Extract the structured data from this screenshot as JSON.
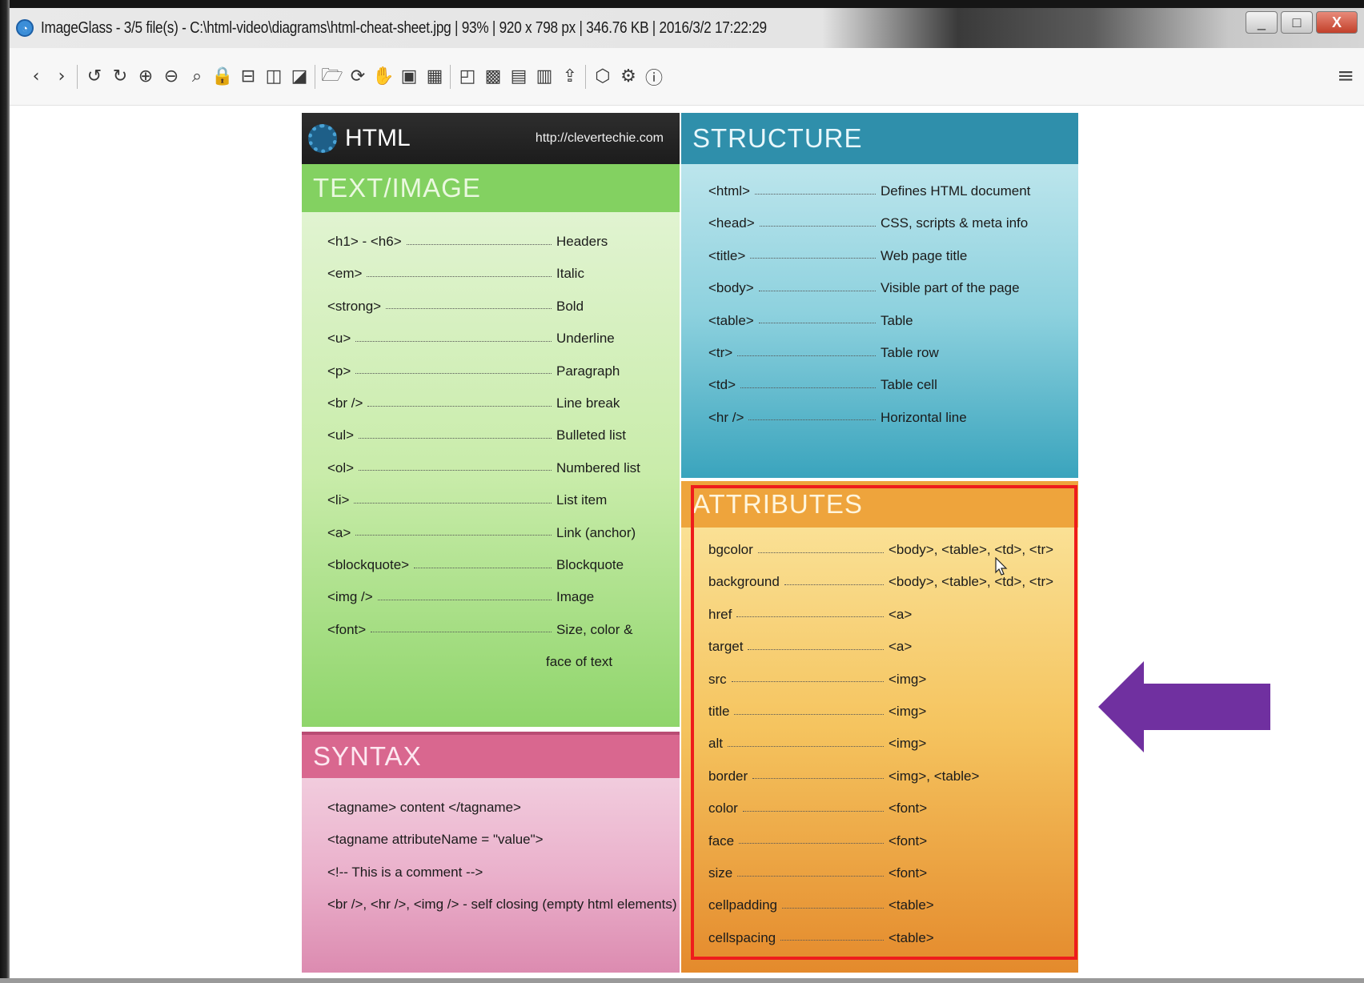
{
  "window": {
    "title": "ImageGlass - 3/5 file(s) - C:\\html-video\\diagrams\\html-cheat-sheet.jpg  |  93%  |  920 x 798 px  |  346.76 KB  |  2016/3/2 17:22:29",
    "buttons": {
      "minimize": "_",
      "maximize": "□",
      "close": "X"
    }
  },
  "toolbar": {
    "icons": [
      "back-icon",
      "forward-icon",
      "rotate-left-icon",
      "rotate-right-icon",
      "zoom-in-icon",
      "zoom-out-icon",
      "zoom-fit-icon",
      "lock-icon",
      "scale-width-icon",
      "scale-height-icon",
      "auto-fit-icon",
      "open-folder-icon",
      "refresh-icon",
      "hand-icon",
      "image-icon",
      "thumbnail-icon",
      "checkerboard-icon",
      "fullscreen-icon",
      "save-icon",
      "print-icon",
      "upload-icon",
      "plugin-icon",
      "settings-icon",
      "about-icon"
    ],
    "glyphs": [
      "‹",
      "›",
      "↺",
      "↻",
      "⊕",
      "⊖",
      "⌕",
      "🔒",
      "⊟",
      "◫",
      "◪",
      "🗁",
      "⟳",
      "✋",
      "▣",
      "▦",
      "◰",
      "▩",
      "▤",
      "▥",
      "⇪",
      "⬡",
      "⚙",
      "ⓘ"
    ],
    "menu_icon": "≡"
  },
  "sheet": {
    "brand_title": "HTML",
    "brand_url": "http://clevertechie.com",
    "text_image": {
      "heading": "TEXT/IMAGE",
      "rows": [
        {
          "tag": "<h1> - <h6>",
          "desc": "Headers"
        },
        {
          "tag": "<em>",
          "desc": "Italic"
        },
        {
          "tag": "<strong>",
          "desc": "Bold"
        },
        {
          "tag": "<u>",
          "desc": "Underline"
        },
        {
          "tag": "<p>",
          "desc": "Paragraph"
        },
        {
          "tag": "<br />",
          "desc": "Line break"
        },
        {
          "tag": "<ul>",
          "desc": "Bulleted list"
        },
        {
          "tag": "<ol>",
          "desc": "Numbered list"
        },
        {
          "tag": "<li>",
          "desc": "List item"
        },
        {
          "tag": "<a>",
          "desc": "Link (anchor)"
        },
        {
          "tag": "<blockquote>",
          "desc": "Blockquote"
        },
        {
          "tag": "<img />",
          "desc": "Image"
        },
        {
          "tag": "<font>",
          "desc": "Size, color &"
        }
      ],
      "continuation": "face of text"
    },
    "syntax": {
      "heading": "SYNTAX",
      "lines": [
        "<tagname>  content  </tagname>",
        "<tagname attributeName = \"value\">",
        "<!-- This is a comment -->",
        "<br />, <hr />, <img /> - self closing (empty html elements)"
      ]
    },
    "structure": {
      "heading": "STRUCTURE",
      "rows": [
        {
          "tag": "<html>",
          "desc": "Defines HTML document"
        },
        {
          "tag": "<head>",
          "desc": "CSS, scripts & meta info"
        },
        {
          "tag": "<title>",
          "desc": "Web page title"
        },
        {
          "tag": "<body>",
          "desc": "Visible part of the page"
        },
        {
          "tag": "<table>",
          "desc": "Table"
        },
        {
          "tag": "<tr>",
          "desc": "Table row"
        },
        {
          "tag": "<td>",
          "desc": "Table cell"
        },
        {
          "tag": "<hr />",
          "desc": "Horizontal line"
        }
      ]
    },
    "attributes": {
      "heading": "ATTRIBUTES",
      "rows": [
        {
          "tag": "bgcolor",
          "desc": "<body>, <table>, <td>, <tr>"
        },
        {
          "tag": "background",
          "desc": "<body>, <table>, <td>, <tr>"
        },
        {
          "tag": "href",
          "desc": "<a>"
        },
        {
          "tag": "target",
          "desc": "<a>"
        },
        {
          "tag": "src",
          "desc": "<img>"
        },
        {
          "tag": "title",
          "desc": "<img>"
        },
        {
          "tag": "alt",
          "desc": "<img>"
        },
        {
          "tag": "border",
          "desc": "<img>, <table>"
        },
        {
          "tag": "color",
          "desc": "<font>"
        },
        {
          "tag": "face",
          "desc": "<font>"
        },
        {
          "tag": "size",
          "desc": "<font>"
        },
        {
          "tag": "cellpadding",
          "desc": "<table>"
        },
        {
          "tag": "cellspacing",
          "desc": "<table>"
        }
      ]
    }
  },
  "annotations": {
    "highlight_color": "#ee1c1c",
    "arrow_color": "#7030a0"
  }
}
